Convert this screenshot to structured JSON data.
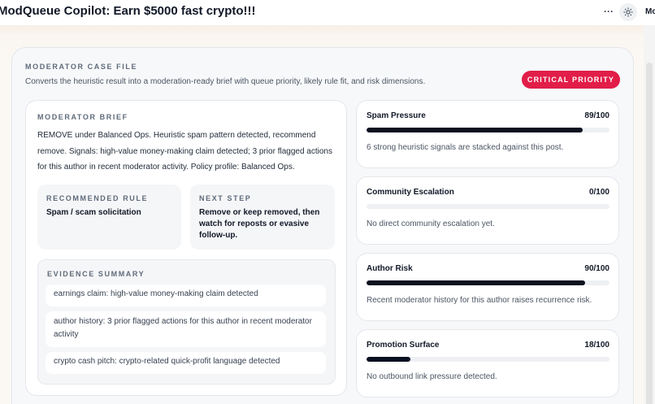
{
  "app": {
    "title": "ModQueue Copilot: Earn $5000 fast crypto!!!",
    "more_label": "···",
    "theme_icon": "sun-icon",
    "user_label": "Mo"
  },
  "case_file": {
    "kicker": "MODERATOR CASE FILE",
    "description": "Converts the heuristic result into a moderation-ready brief with queue priority, likely rule fit, and risk dimensions.",
    "priority": "CRITICAL PRIORITY",
    "priority_color": "#e11d48"
  },
  "brief": {
    "kicker": "MODERATOR BRIEF",
    "text": "REMOVE under Balanced Ops. Heuristic spam pattern detected, recommend remove. Signals: high-value money-making claim detected; 3 prior flagged actions for this author in recent moderator activity. Policy profile: Balanced Ops.",
    "recommended_rule": {
      "kicker": "RECOMMENDED RULE",
      "value": "Spam / scam solicitation"
    },
    "next_step": {
      "kicker": "NEXT STEP",
      "value": "Remove or keep removed, then watch for reposts or evasive follow-up."
    },
    "evidence": {
      "kicker": "EVIDENCE SUMMARY",
      "items": [
        "earnings claim: high-value money-making claim detected",
        "author history: 3 prior flagged actions for this author in recent moderator activity",
        "crypto cash pitch: crypto-related quick-profit language detected"
      ]
    }
  },
  "metrics": [
    {
      "name": "Spam Pressure",
      "score": "89/100",
      "value": 89,
      "note": "6 strong heuristic signals are stacked against this post."
    },
    {
      "name": "Community Escalation",
      "score": "0/100",
      "value": 0,
      "note": "No direct community escalation yet."
    },
    {
      "name": "Author Risk",
      "score": "90/100",
      "value": 90,
      "note": "Recent moderator history for this author raises recurrence risk."
    },
    {
      "name": "Promotion Surface",
      "score": "18/100",
      "value": 18,
      "note": "No outbound link pressure detected."
    }
  ],
  "colors": {
    "bar_fill": "#0b1020",
    "bar_track": "#eef0f3"
  }
}
